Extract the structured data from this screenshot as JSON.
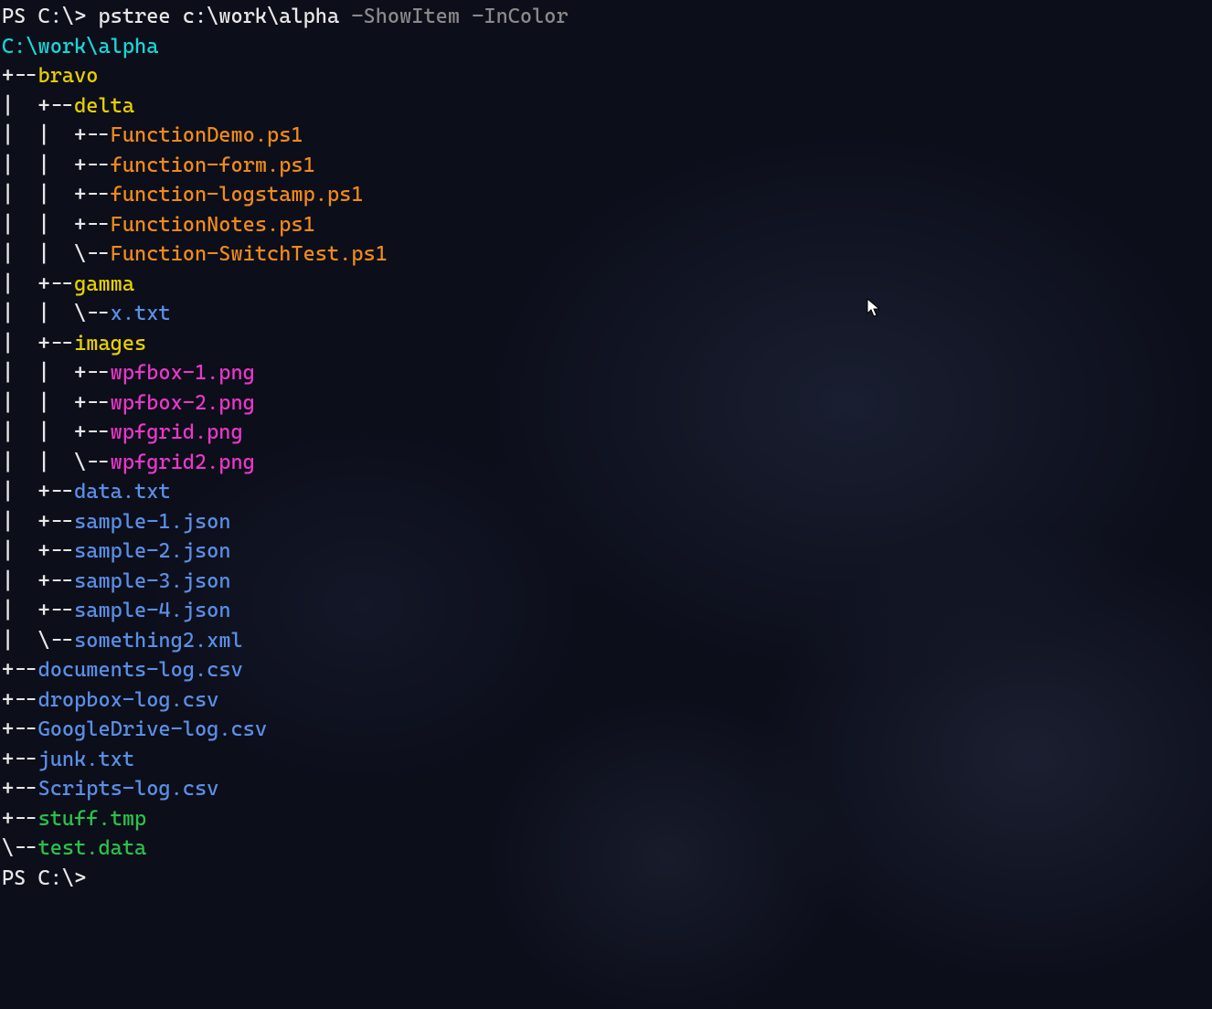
{
  "colors": {
    "prompt": "#e8e8e8",
    "flag": "#8a8a8a",
    "root": "#18d7d7",
    "dir": "#e8d000",
    "ps1": "#f08a1c",
    "generic_file": "#5a8fe6",
    "image_file": "#e838c8",
    "temp_file": "#2bc24a"
  },
  "prompt1": {
    "ps": "PS C:\\>",
    "command": "pstree",
    "arg": "c:\\work\\alpha",
    "flags": "-ShowItem -InColor"
  },
  "root_path": "C:\\work\\alpha",
  "tree": {
    "bravo": {
      "type": "dir",
      "children": {
        "delta": {
          "type": "dir",
          "files": [
            "FunctionDemo.ps1",
            "function-form.ps1",
            "function-logstamp.ps1",
            "FunctionNotes.ps1",
            "Function-SwitchTest.ps1"
          ],
          "file_type": "ps1"
        },
        "gamma": {
          "type": "dir",
          "files": [
            "x.txt"
          ],
          "file_type": "txt"
        },
        "images": {
          "type": "dir",
          "files": [
            "wpfbox-1.png",
            "wpfbox-2.png",
            "wpfgrid.png",
            "wpfgrid2.png"
          ],
          "file_type": "png"
        }
      },
      "files": [
        {
          "name": "data.txt",
          "type": "txt"
        },
        {
          "name": "sample-1.json",
          "type": "json"
        },
        {
          "name": "sample-2.json",
          "type": "json"
        },
        {
          "name": "sample-3.json",
          "type": "json"
        },
        {
          "name": "sample-4.json",
          "type": "json"
        },
        {
          "name": "something2.xml",
          "type": "xml"
        }
      ]
    },
    "root_files": [
      {
        "name": "documents-log.csv",
        "type": "csv"
      },
      {
        "name": "dropbox-log.csv",
        "type": "csv"
      },
      {
        "name": "GoogleDrive-log.csv",
        "type": "csv"
      },
      {
        "name": "junk.txt",
        "type": "txt"
      },
      {
        "name": "Scripts-log.csv",
        "type": "csv"
      },
      {
        "name": "stuff.tmp",
        "type": "tmp"
      },
      {
        "name": "test.data",
        "type": "databin"
      }
    ]
  },
  "prompt2": "PS C:\\>",
  "tree_glyphs": {
    "tee": "+--",
    "elbow": "\\--",
    "vbar": "|  ",
    "space": "   "
  }
}
